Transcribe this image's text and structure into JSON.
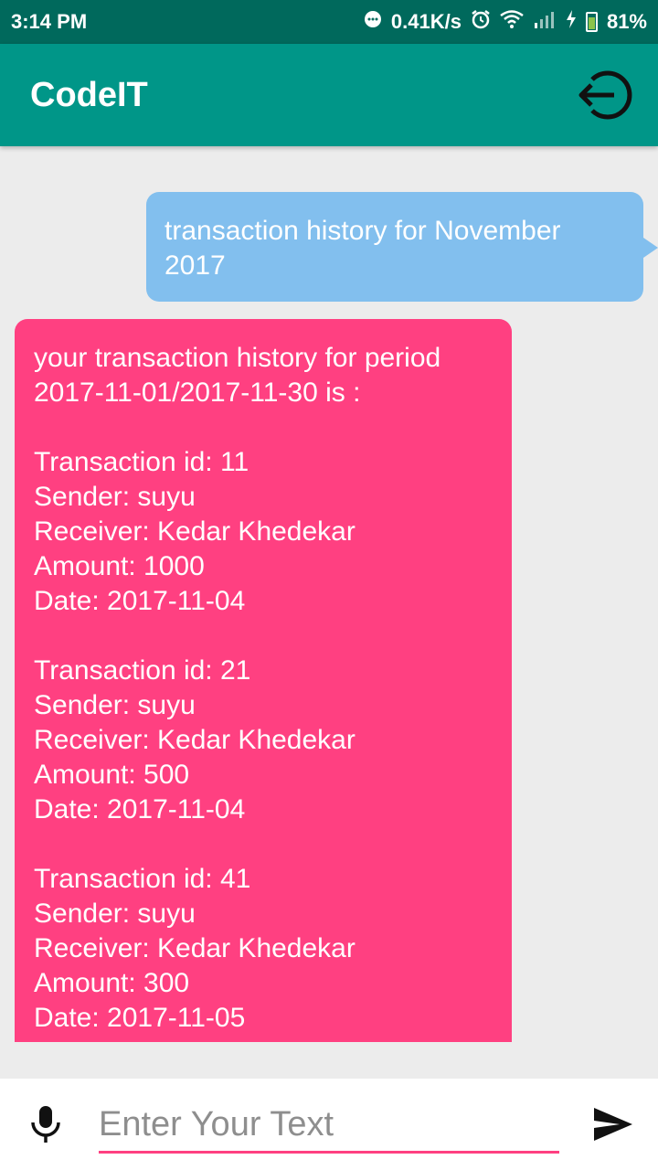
{
  "status_bar": {
    "time": "3:14 PM",
    "net_speed": "0.41K/s",
    "battery_percent": "81%",
    "icons": [
      "message-icon",
      "alarm-icon",
      "wifi-icon",
      "signal-icon",
      "charging-icon",
      "battery-icon"
    ]
  },
  "app_bar": {
    "title": "CodeIT",
    "logout_icon": "logout-icon"
  },
  "chat": {
    "user_message": "transaction history for November 2017",
    "bot_message": {
      "intro": "your transaction history for period 2017-11-01/2017-11-30 is :",
      "transactions": [
        {
          "id_line": "Transaction id: 11",
          "sender_line": "Sender: suyu",
          "receiver_line": "Receiver: Kedar Khedekar",
          "amount_line": "Amount: 1000",
          "date_line": "Date: 2017-11-04"
        },
        {
          "id_line": "Transaction id: 21",
          "sender_line": "Sender: suyu",
          "receiver_line": "Receiver: Kedar Khedekar",
          "amount_line": "Amount: 500",
          "date_line": "Date: 2017-11-04"
        },
        {
          "id_line": "Transaction id: 41",
          "sender_line": "Sender: suyu",
          "receiver_line": "Receiver: Kedar Khedekar",
          "amount_line": "Amount: 300",
          "date_line": "Date: 2017-11-05"
        }
      ]
    }
  },
  "input_bar": {
    "placeholder": "Enter Your Text",
    "value": "",
    "mic_icon": "mic-icon",
    "send_icon": "send-icon"
  },
  "colors": {
    "status_bar": "#00695c",
    "app_bar": "#009688",
    "user_bubble": "#82bfee",
    "bot_bubble": "#ff4081",
    "background": "#ececec"
  }
}
